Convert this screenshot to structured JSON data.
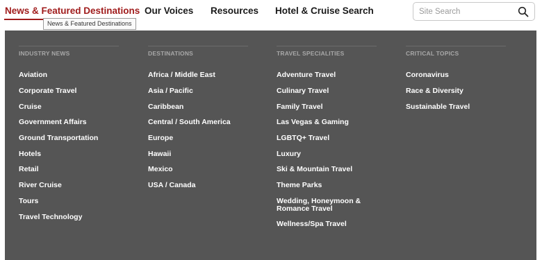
{
  "nav": {
    "items": [
      {
        "label": "News & Featured Destinations",
        "active": true
      },
      {
        "label": "Our Voices"
      },
      {
        "label": "Resources"
      },
      {
        "label": "Hotel & Cruise Search"
      }
    ],
    "tooltip": "News & Featured Destinations"
  },
  "search": {
    "placeholder": "Site Search",
    "value": "",
    "icon": "search-icon"
  },
  "menu": {
    "industry": {
      "heading": "INDUSTRY NEWS",
      "links": [
        "Aviation",
        "Corporate Travel",
        "Cruise",
        "Government Affairs",
        "Ground Transportation",
        "Hotels",
        "Retail",
        "River Cruise",
        "Tours",
        "Travel Technology"
      ]
    },
    "destinations": {
      "heading": "DESTINATIONS",
      "links": [
        "Africa / Middle East",
        "Asia / Pacific",
        "Caribbean",
        "Central / South America",
        "Europe",
        "Hawaii",
        "Mexico",
        "USA / Canada"
      ]
    },
    "specialities": {
      "heading": "TRAVEL SPECIALITIES",
      "links": [
        "Adventure Travel",
        "Culinary Travel",
        "Family Travel",
        "Las Vegas & Gaming",
        "LGBTQ+ Travel",
        "Luxury",
        "Ski & Mountain Travel",
        "Theme Parks",
        "Wedding, Honeymoon & Romance Travel",
        "Wellness/Spa Travel"
      ]
    },
    "topics": {
      "heading": "CRITICAL TOPICS",
      "links": [
        "Coronavirus",
        "Race & Diversity",
        "Sustainable Travel"
      ]
    }
  },
  "colors": {
    "accent": "#a01c1c",
    "menu_bg": "#555555",
    "heading": "#a8a8a8",
    "link": "#ffffff"
  }
}
